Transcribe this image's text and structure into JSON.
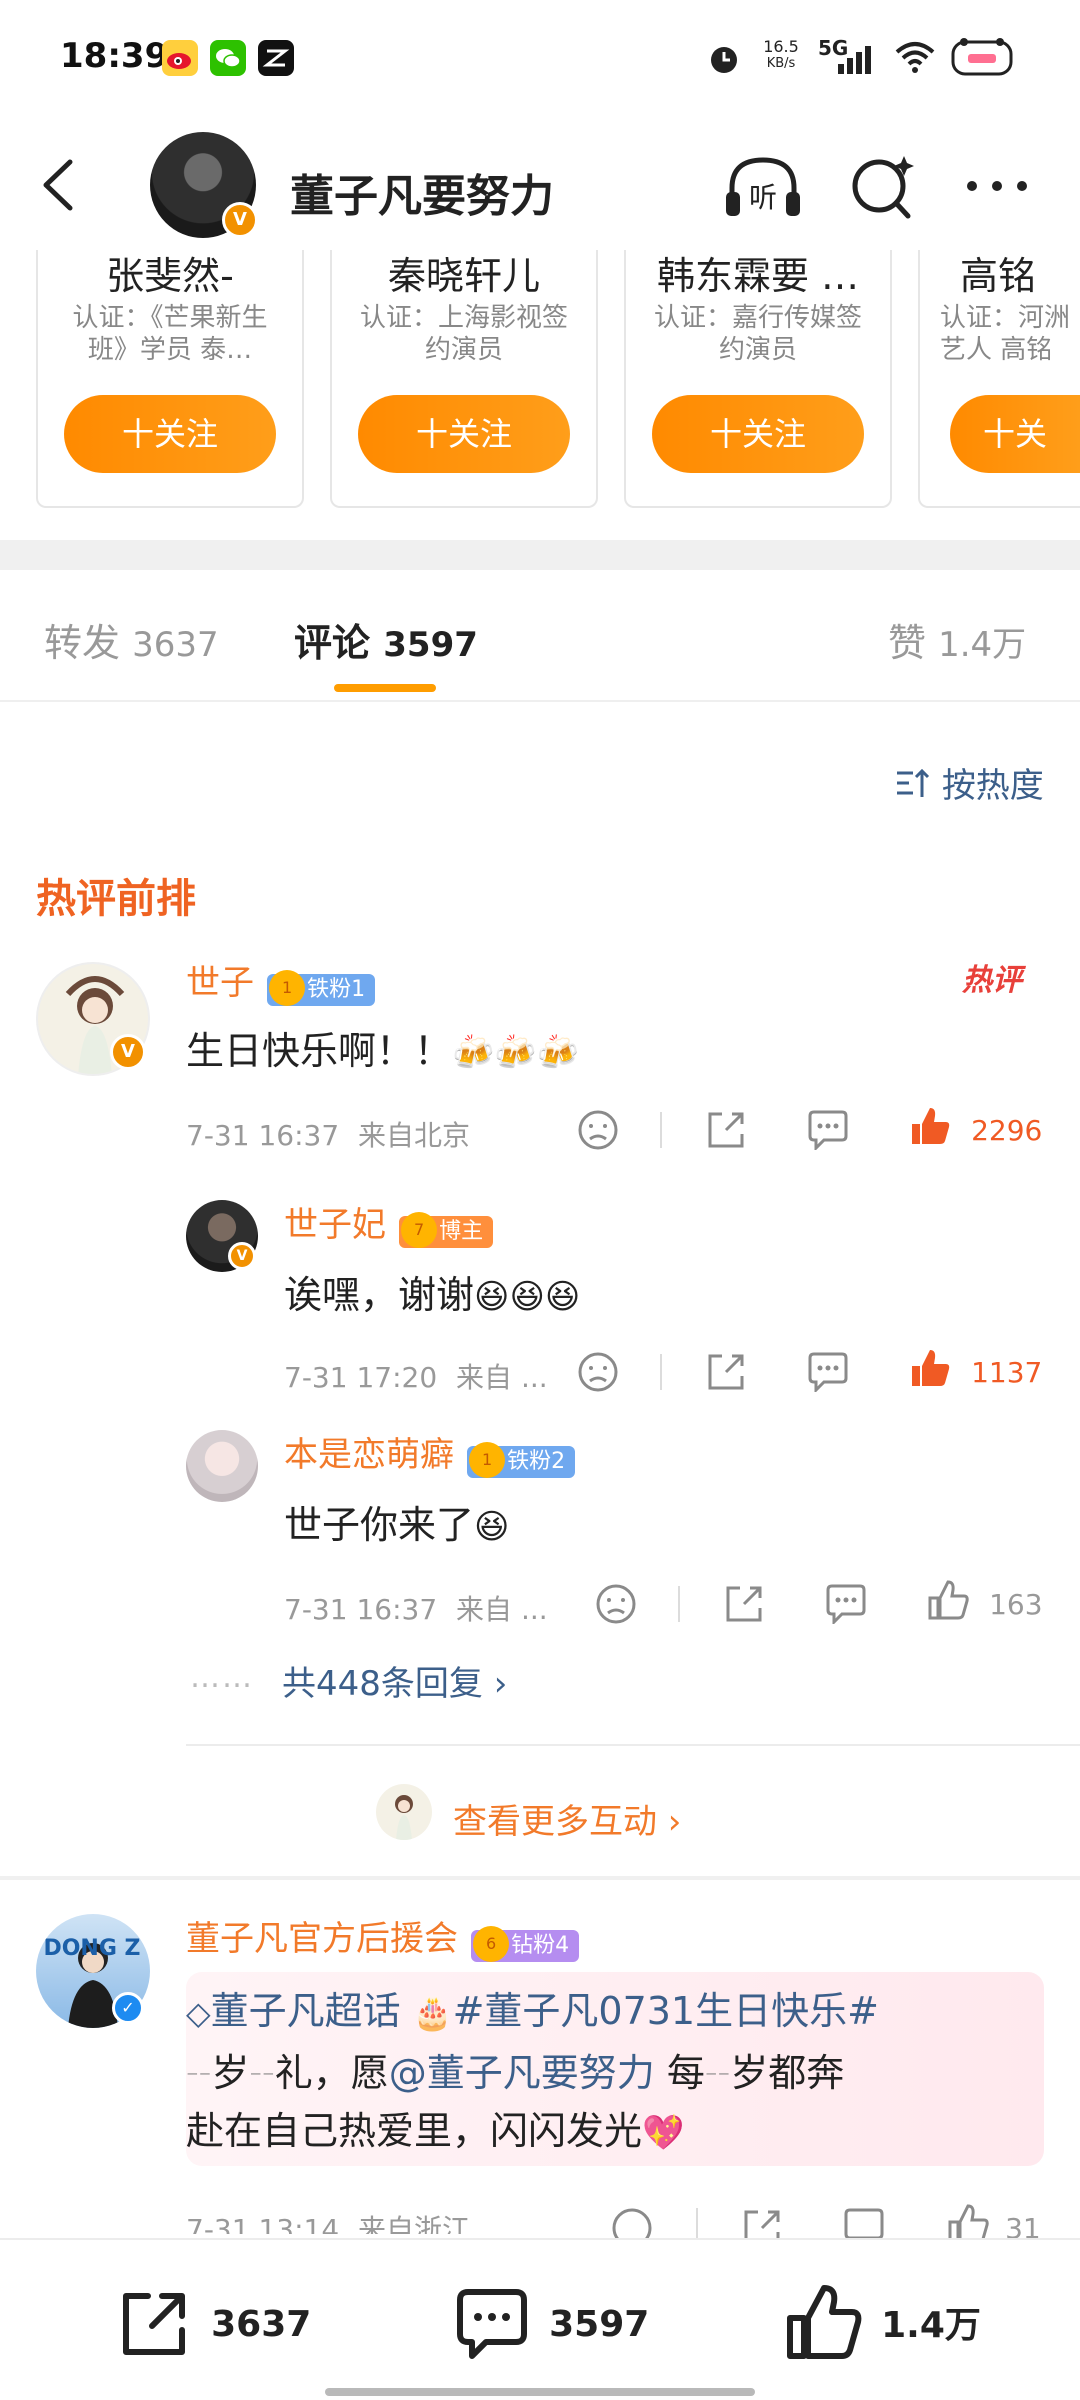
{
  "status_bar": {
    "time": "18:39",
    "net_speed_value": "16.5",
    "net_speed_unit": "KB/s",
    "network": "5G",
    "icons": [
      "weibo-app-icon",
      "wechat-app-icon",
      "capcut-app-icon",
      "alarm-icon",
      "signal-icon",
      "wifi-icon",
      "battery-icon"
    ]
  },
  "header": {
    "title": "董子凡要努力",
    "verified_mark": "V"
  },
  "recommend_cards": [
    {
      "name": "张斐然-",
      "cert": "认证：《芒果新生班》学员 泰…",
      "button": "十关注"
    },
    {
      "name": "秦晓轩儿",
      "cert": "认证：上海影视签约演员",
      "button": "十关注"
    },
    {
      "name": "韩东霖要 …",
      "cert": "认证：嘉行传媒签约演员",
      "button": "十关注"
    },
    {
      "name": "高铭",
      "cert": "认证：河洲艺人 高铭",
      "button": "十关"
    }
  ],
  "tabs": [
    {
      "label": "转发",
      "count": "3637"
    },
    {
      "label": "评论",
      "count": "3597"
    },
    {
      "label": "赞",
      "count": "1.4万"
    }
  ],
  "sort_label": "按热度",
  "hot_section_title": "热评前排",
  "hot_tag": "热评",
  "comments": [
    {
      "user": "世子",
      "badge": "铁粉1",
      "badge_level": "1",
      "text": "生日快乐啊！！",
      "emoji": "🍻🍻🍻",
      "time": "7-31 16:37",
      "location": "来自北京",
      "likes": "2296"
    },
    {
      "user": "世子妃",
      "badge": "博主",
      "badge_level": "7",
      "text": "诶嘿，谢谢",
      "emoji": "😆😆😆",
      "time": "7-31 17:20",
      "location": "来自 ...",
      "likes": "1137"
    },
    {
      "user": "本是恋萌癖",
      "badge": "铁粉2",
      "badge_level": "1",
      "text": "世子你来了",
      "emoji": "😆",
      "time": "7-31 16:37",
      "location": "来自 ...",
      "likes": "163"
    }
  ],
  "more_replies": "共448条回复 ›",
  "more_dots": "……",
  "view_more_interactions": "查看更多互动 ›",
  "comment4": {
    "user": "董子凡官方后援会",
    "badge": "钻粉4",
    "badge_level": "6",
    "avatar_text": "DONG Z",
    "line1_supertopic": "董子凡超话",
    "line1_hashtag": "#董子凡0731生日快乐#",
    "line2_a": "岁",
    "line2_b": "礼，愿",
    "line2_mention": "@董子凡要努力",
    "line2_c": "每",
    "line2_d": "岁都奔",
    "line3": "赴在自己热爱里，闪闪发光",
    "line3_emoji": "💖",
    "time": "7-31 13:14",
    "location": "来自浙江",
    "likes": "31"
  },
  "bottom_bar": {
    "repost": "3637",
    "comment": "3597",
    "like": "1.4万"
  },
  "colors": {
    "accent_orange": "#ff9d00",
    "username_orange": "#f27a2a",
    "hot_red": "#f05a24",
    "link_blue": "#3c5f8a"
  }
}
